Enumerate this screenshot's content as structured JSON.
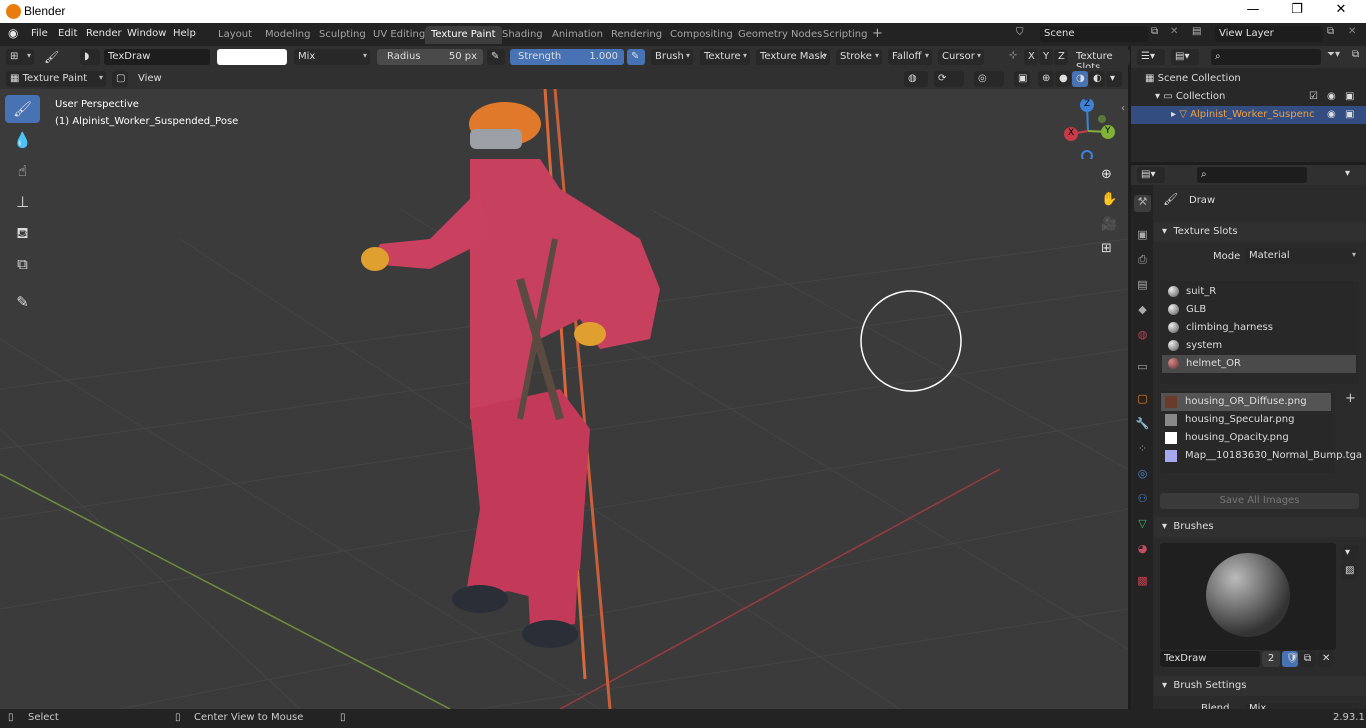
{
  "window": {
    "title": "Blender",
    "controls": {
      "minimize": "—",
      "maximize": "❐",
      "close": "✕"
    }
  },
  "menus": [
    "File",
    "Edit",
    "Render",
    "Window",
    "Help"
  ],
  "workspaces": [
    "Layout",
    "Modeling",
    "Sculpting",
    "UV Editing",
    "Texture Paint",
    "Shading",
    "Animation",
    "Rendering",
    "Compositing",
    "Geometry Nodes",
    "Scripting"
  ],
  "active_workspace": "Texture Paint",
  "scene": {
    "name": "Scene",
    "view_layer": "View Layer"
  },
  "tool_header": {
    "brush_name": "TexDraw",
    "blend": "Mix",
    "radius_label": "Radius",
    "radius_value": "50 px",
    "strength_label": "Strength",
    "strength_value": "1.000",
    "strength_fraction": 1.0,
    "menus": [
      "Brush",
      "Texture",
      "Texture Mask",
      "Stroke",
      "Falloff",
      "Cursor"
    ],
    "axes": [
      "X",
      "Y",
      "Z"
    ],
    "texture_slots_label": "Texture Slots"
  },
  "viewport_header": {
    "mode": "Texture Paint",
    "view": "View"
  },
  "viewport": {
    "perspective": "User Perspective",
    "object": "(1) Alpinist_Worker_Suspended_Pose",
    "gizmo": {
      "z": "Z",
      "y": "Y",
      "x": "X"
    }
  },
  "outliner": {
    "scene_collection": "Scene Collection",
    "collection": "Collection",
    "object": "Alpinist_Worker_Suspenc"
  },
  "properties": {
    "active_tool": "Draw",
    "texture_slots_title": "Texture Slots",
    "mode_label": "Mode",
    "mode_value": "Material",
    "materials": [
      "suit_R",
      "GLB",
      "climbing_harness",
      "system",
      "helmet_OR"
    ],
    "selected_material": "helmet_OR",
    "images": [
      "housing_OR_Diffuse.png",
      "housing_Specular.png",
      "housing_Opacity.png",
      "Map__10183630_Normal_Bump.tga"
    ],
    "selected_image": "housing_OR_Diffuse.png",
    "save_all": "Save All Images",
    "brushes_title": "Brushes",
    "brush_name": "TexDraw",
    "brush_users": "2",
    "brush_settings_title": "Brush Settings",
    "blend_partial": "Blend",
    "blend_value_partial": "Mix"
  },
  "statusbar": {
    "select": "Select",
    "center": "Center View to Mouse",
    "version": "2.93.1"
  },
  "colors": {
    "accent": "#4772b3",
    "header": "#303030",
    "viewport": "#3a3a3a",
    "x_axis": "#c63b45",
    "y_axis": "#7fb236",
    "z_axis": "#3f83d9"
  }
}
